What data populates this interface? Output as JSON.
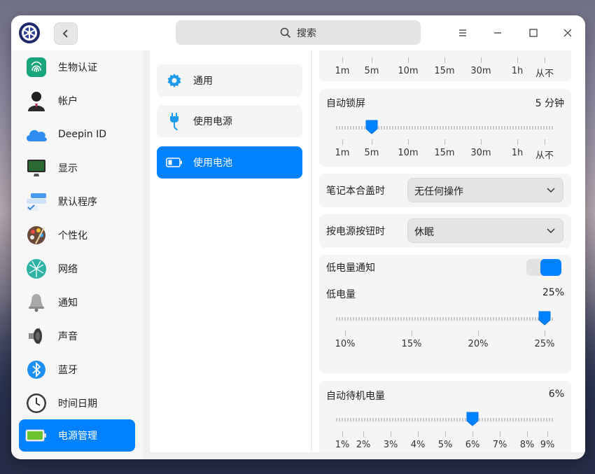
{
  "titlebar": {
    "search_placeholder": "搜索"
  },
  "sidebar": {
    "items": [
      {
        "label": "生物认证",
        "icon": "fingerprint-icon"
      },
      {
        "label": "帐户",
        "icon": "account-icon"
      },
      {
        "label": "Deepin ID",
        "icon": "cloud-icon"
      },
      {
        "label": "显示",
        "icon": "monitor-icon"
      },
      {
        "label": "默认程序",
        "icon": "default-apps-icon"
      },
      {
        "label": "个性化",
        "icon": "palette-icon"
      },
      {
        "label": "网络",
        "icon": "network-icon"
      },
      {
        "label": "通知",
        "icon": "bell-icon"
      },
      {
        "label": "声音",
        "icon": "speaker-icon"
      },
      {
        "label": "蓝牙",
        "icon": "bluetooth-icon"
      },
      {
        "label": "时间日期",
        "icon": "clock-icon"
      },
      {
        "label": "电源管理",
        "icon": "battery-icon"
      }
    ],
    "active_index": 11
  },
  "subnav": {
    "items": [
      {
        "label": "通用",
        "icon": "gear-icon"
      },
      {
        "label": "使用电源",
        "icon": "plug-icon"
      },
      {
        "label": "使用电池",
        "icon": "battery-icon"
      }
    ],
    "active_index": 2
  },
  "content": {
    "prev_slider_ticks": [
      "1m",
      "5m",
      "10m",
      "15m",
      "30m",
      "1h",
      "从不"
    ],
    "auto_lock": {
      "title": "自动锁屏",
      "value": "5 分钟",
      "ticks": [
        "1m",
        "5m",
        "10m",
        "15m",
        "30m",
        "1h",
        "从不"
      ],
      "selected_index": 1
    },
    "lid_close": {
      "title": "笔记本合盖时",
      "selected": "无任何操作"
    },
    "power_button": {
      "title": "按电源按钮时",
      "selected": "休眠"
    },
    "low_battery_notify": {
      "title": "低电量通知",
      "enabled": true
    },
    "low_battery": {
      "title": "低电量",
      "value": "25%",
      "ticks": [
        "10%",
        "15%",
        "20%",
        "25%"
      ],
      "selected_index": 3
    },
    "auto_suspend": {
      "title": "自动待机电量",
      "value": "6%",
      "ticks": [
        "1%",
        "2%",
        "3%",
        "4%",
        "5%",
        "6%",
        "7%",
        "8%",
        "9%"
      ],
      "selected_index": 5
    }
  },
  "colors": {
    "accent": "#0081ff",
    "window_bg": "#f0f0f0",
    "card_bg": "#f5f5f5"
  }
}
